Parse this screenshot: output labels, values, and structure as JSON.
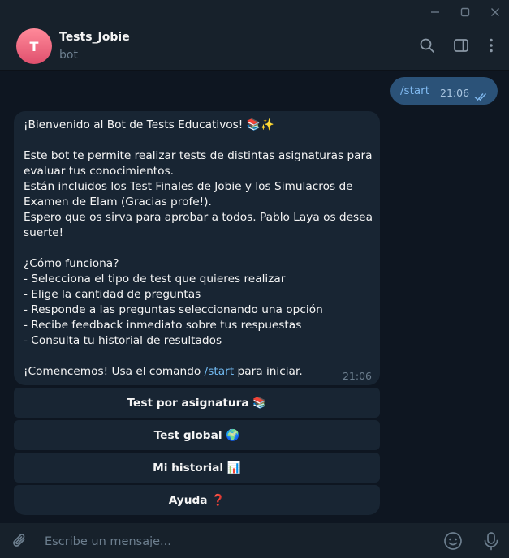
{
  "window": {
    "minimize_icon": "minimize-icon",
    "maximize_icon": "maximize-icon",
    "close_icon": "close-icon"
  },
  "header": {
    "avatar_letter": "T",
    "title": "Tests_Jobie",
    "status": "bot",
    "icons": [
      "search-icon",
      "sidebar-toggle-icon",
      "more-vertical-icon"
    ]
  },
  "outgoing": {
    "text": "/start",
    "time": "21:06",
    "status_icon": "double-check-icon"
  },
  "incoming": {
    "lines": [
      "¡Bienvenido al Bot de Tests Educativos! 📚✨",
      "",
      "Este bot te permite realizar tests de distintas asignaturas para",
      "evaluar tus conocimientos.",
      "Están incluidos los Test Finales de Jobie y los Simulacros de",
      "Examen de Elam (Gracias profe!).",
      "Espero que os sirva para aprobar a todos. Pablo Laya os desea",
      "suerte!",
      "",
      "¿Cómo funciona?",
      "- Selecciona el tipo de test que quieres realizar",
      "- Elige la cantidad de preguntas",
      "- Responde a las preguntas seleccionando una opción",
      "- Recibe feedback inmediato sobre tus respuestas",
      "- Consulta tu historial de resultados",
      ""
    ],
    "last_line_before": "¡Comencemos! Usa el comando ",
    "last_line_command": "/start",
    "last_line_after": " para iniciar.",
    "time": "21:06"
  },
  "keyboard": {
    "buttons": [
      "Test por asignatura 📚",
      "Test global 🌍",
      "Mi historial 📊",
      "Ayuda ❓"
    ]
  },
  "composer": {
    "placeholder": "Escribe un mensaje...",
    "attach_icon": "paperclip-icon",
    "emoji_icon": "emoji-icon",
    "mic_icon": "microphone-icon"
  },
  "colors": {
    "background": "#0e1621",
    "panel": "#17212b",
    "incoming_bubble": "#182533",
    "outgoing_bubble": "#2b5278",
    "link": "#71b9f0",
    "avatar": "#e0506e"
  }
}
